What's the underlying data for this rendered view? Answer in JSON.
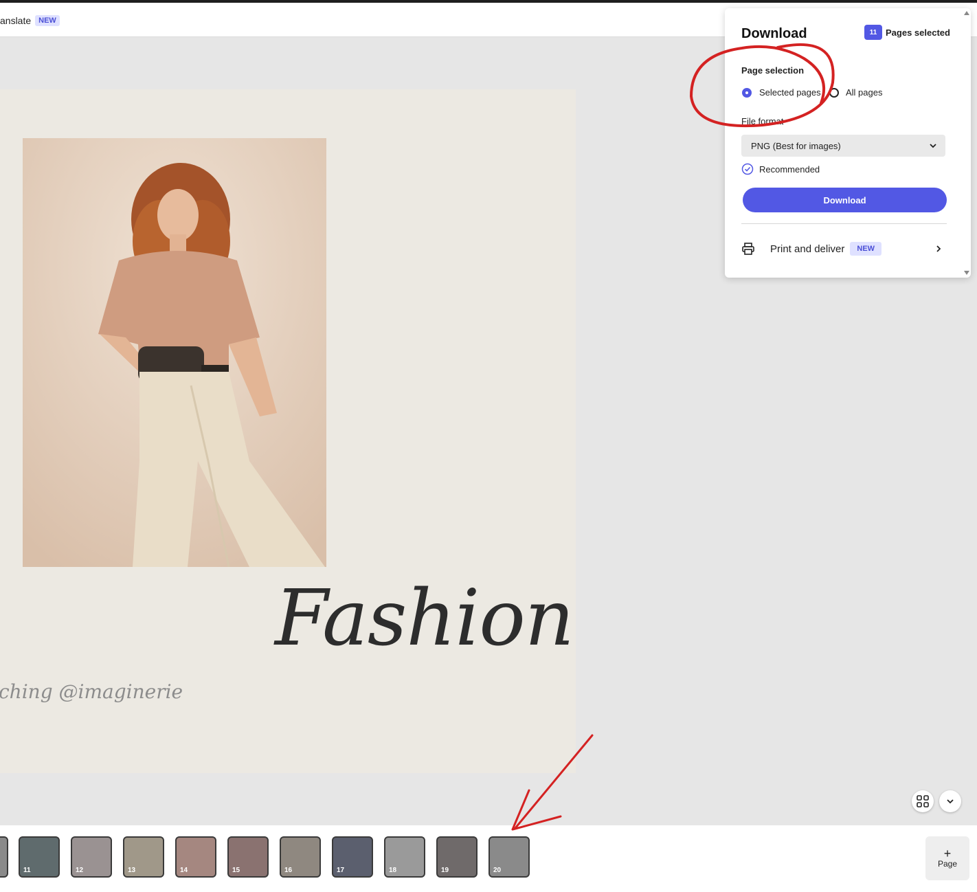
{
  "topbar": {
    "translate_label": "anslate",
    "translate_badge": "NEW"
  },
  "canvas": {
    "title": "Fashion",
    "credit": "ching @imaginerie"
  },
  "panel": {
    "title": "Download",
    "pages_selected_count": "11",
    "pages_selected_label": "Pages selected",
    "page_selection_label": "Page selection",
    "radio_selected_pages": "Selected pages",
    "radio_all_pages": "All pages",
    "selected_option": "Selected pages",
    "file_format_label": "File format",
    "file_format_value": "PNG (Best for images)",
    "recommended_label": "Recommended",
    "download_button": "Download",
    "print_label": "Print and deliver",
    "print_badge": "NEW",
    "accent_color": "#5258e4"
  },
  "thumbnails": [
    {
      "num": ""
    },
    {
      "num": "11"
    },
    {
      "num": "12"
    },
    {
      "num": "13"
    },
    {
      "num": "14"
    },
    {
      "num": "15"
    },
    {
      "num": "16"
    },
    {
      "num": "17"
    },
    {
      "num": "18"
    },
    {
      "num": "19"
    },
    {
      "num": "20"
    }
  ],
  "add_page_label": "Page",
  "icons": {
    "grid_view": "grid-icon",
    "collapse": "chevron-down-icon",
    "print": "printer-icon",
    "print_arrow": "chevron-right-icon"
  }
}
